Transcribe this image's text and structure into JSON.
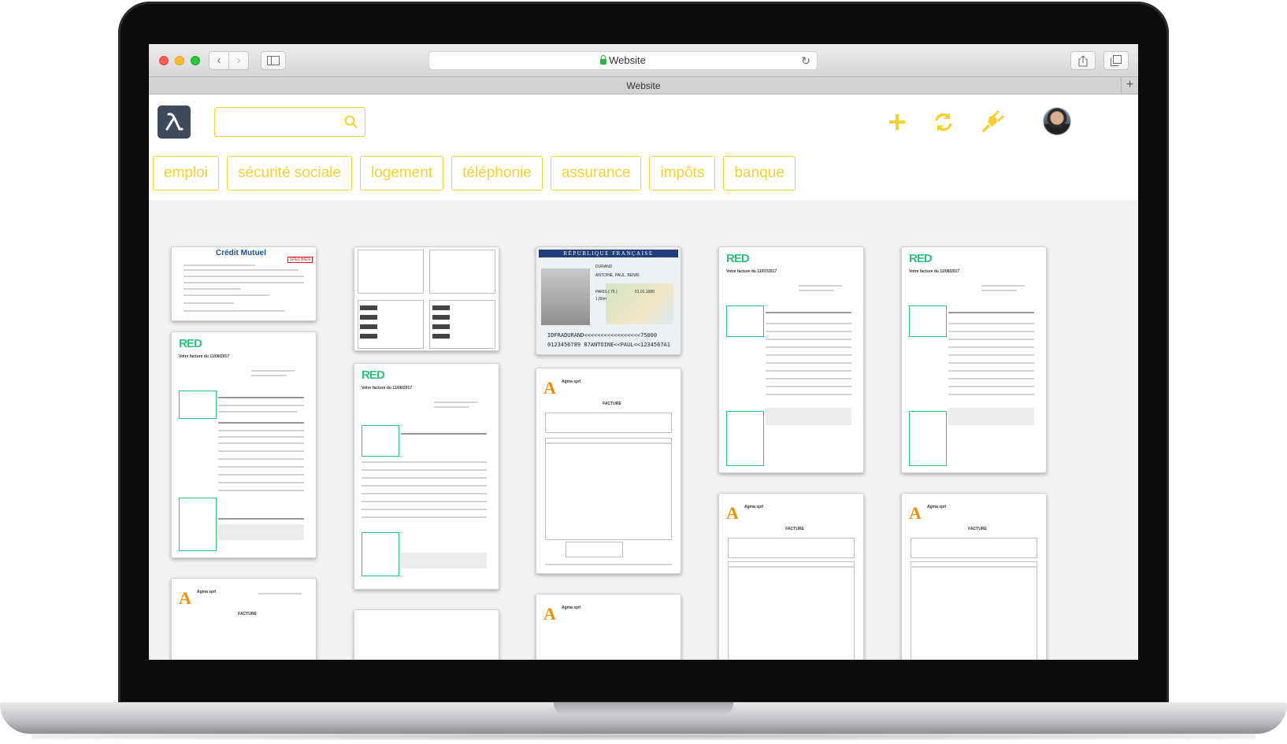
{
  "browser": {
    "address": "Website",
    "tab_title": "Website",
    "new_tab": "+",
    "back": "‹",
    "forward": "›"
  },
  "app": {
    "search": {
      "placeholder": "",
      "value": ""
    },
    "actions": [
      {
        "name": "add",
        "icon": "plus-icon"
      },
      {
        "name": "sync",
        "icon": "sync-icon"
      },
      {
        "name": "plugin",
        "icon": "plug-icon"
      }
    ],
    "accent_color": "#f5d02f",
    "logo_color": "#3d4b5c"
  },
  "categories": [
    "emploi",
    "sécurité sociale",
    "logement",
    "téléphonie",
    "assurance",
    "impôts",
    "banque"
  ],
  "documents": {
    "red_brand": "RED",
    "red_title": "Votre facture du 11/08/2017",
    "red_title_alt": "Votre facture du 11/07/2017",
    "agma_logo": "A",
    "agma_name": "Agma sprl",
    "agma_invoice": "FACTURE",
    "cm_brand": "Crédit Mutuel",
    "cm_specimen": "SPECIMEN",
    "id_header": "RÉPUBLIQUE FRANÇAISE",
    "id_name": "DURAND",
    "id_given": "ANTOINE, PAUL, BENRI",
    "id_birth": "PARIS ( 75 )",
    "id_height": "1,80m",
    "id_date": "01.01.1960",
    "id_mrz_1": "IDFRADURAND<<<<<<<<<<<<<<<<<75000",
    "id_mrz_2": "0123456789 87ANTOINE<<PAUL<<1234567A1"
  }
}
